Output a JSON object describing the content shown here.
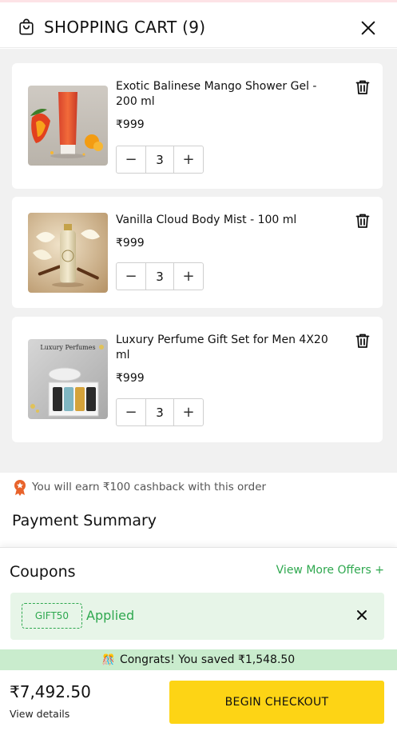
{
  "header": {
    "title": "SHOPPING CART (9)"
  },
  "items": [
    {
      "name": "Exotic Balinese Mango Shower Gel - 200 ml",
      "price": "₹999",
      "qty": "3",
      "image_icon": "mango-shower-gel-photo"
    },
    {
      "name": "Vanilla Cloud Body Mist - 100 ml",
      "price": "₹999",
      "qty": "3",
      "image_icon": "vanilla-body-mist-photo"
    },
    {
      "name": "Luxury Perfume Gift Set for Men 4X20 ml",
      "price": "₹999",
      "qty": "3",
      "image_icon": "perfume-gift-set-photo",
      "image_text": "Luxury Perfumes"
    }
  ],
  "cashback": {
    "text": "You will earn ₹100 cashback with this order"
  },
  "payment_summary": {
    "title": "Payment Summary"
  },
  "coupons": {
    "title": "Coupons",
    "view_more": "View More Offers +",
    "code": "GIFT50",
    "status": "Applied"
  },
  "savings": {
    "congrats": "Congrats!",
    "text": "You saved ₹1,548.50"
  },
  "footer": {
    "total": "₹7,492.50",
    "view_details": "View details",
    "checkout_label": "BEGIN CHECKOUT"
  },
  "colors": {
    "accent_green": "#2fa84f",
    "checkout_yellow": "#fdd415",
    "savings_bg": "#c9eccd"
  }
}
